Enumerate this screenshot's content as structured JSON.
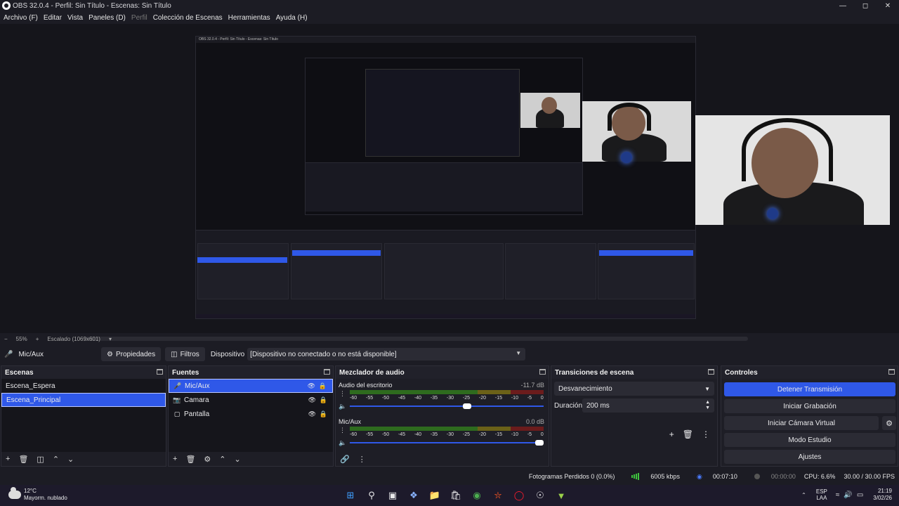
{
  "window": {
    "title": "OBS 32.0.4 - Perfil: Sin Título - Escenas: Sin Título"
  },
  "menu": [
    "Archivo (F)",
    "Editar",
    "Vista",
    "Paneles (D)",
    "Perfil",
    "Colección de Escenas",
    "Herramientas",
    "Ayuda (H)"
  ],
  "zoom": {
    "percent": "55%",
    "scaling": "Escalado (1069x601)"
  },
  "source_toolbar": {
    "source_name": "Mic/Aux",
    "properties_label": "Propiedades",
    "filters_label": "Filtros",
    "device_label": "Dispositivo",
    "device_value": "[Dispositivo no conectado o no está disponible]"
  },
  "scenes": {
    "title": "Escenas",
    "items": [
      "Escena_Espera",
      "Escena_Principal"
    ],
    "selected": 1
  },
  "sources": {
    "title": "Fuentes",
    "items": [
      {
        "name": "Mic/Aux",
        "icon": "microphone-icon"
      },
      {
        "name": "Camara",
        "icon": "camera-icon"
      },
      {
        "name": "Pantalla",
        "icon": "monitor-icon"
      }
    ],
    "selected": 0
  },
  "mixer": {
    "title": "Mezclador de audio",
    "ticks": [
      "-60",
      "-55",
      "-50",
      "-45",
      "-40",
      "-35",
      "-30",
      "-25",
      "-20",
      "-15",
      "-10",
      "-5",
      "0"
    ],
    "channels": [
      {
        "name": "Audio del escritorio",
        "db": "-11.7 dB",
        "volume": 0.61
      },
      {
        "name": "Mic/Aux",
        "db": "0.0 dB",
        "volume": 1.0
      }
    ]
  },
  "transitions": {
    "title": "Transiciones de escena",
    "selected": "Desvanecimiento",
    "duration_label": "Duración",
    "duration_value": "200 ms"
  },
  "controls": {
    "title": "Controles",
    "buttons": [
      "Detener Transmisión",
      "Iniciar Grabación",
      "Iniciar Cámara Virtual",
      "Modo Estudio",
      "Ajustes"
    ]
  },
  "status": {
    "dropped": "Fotogramas Perdidos 0 (0.0%)",
    "bitrate": "6005 kbps",
    "stream_time": "00:07:10",
    "rec_time": "00:00:00",
    "cpu": "CPU: 6.6%",
    "fps": "30.00 / 30.00 FPS"
  },
  "taskbar": {
    "temp": "12°C",
    "weather": "Mayorm. nublado",
    "lang1": "ESP",
    "lang2": "LAA",
    "time": "21:19",
    "date": "3/02/26"
  },
  "colors": {
    "accent": "#2f58e8",
    "background": "#1c1c24",
    "panel": "#1e1e26"
  }
}
